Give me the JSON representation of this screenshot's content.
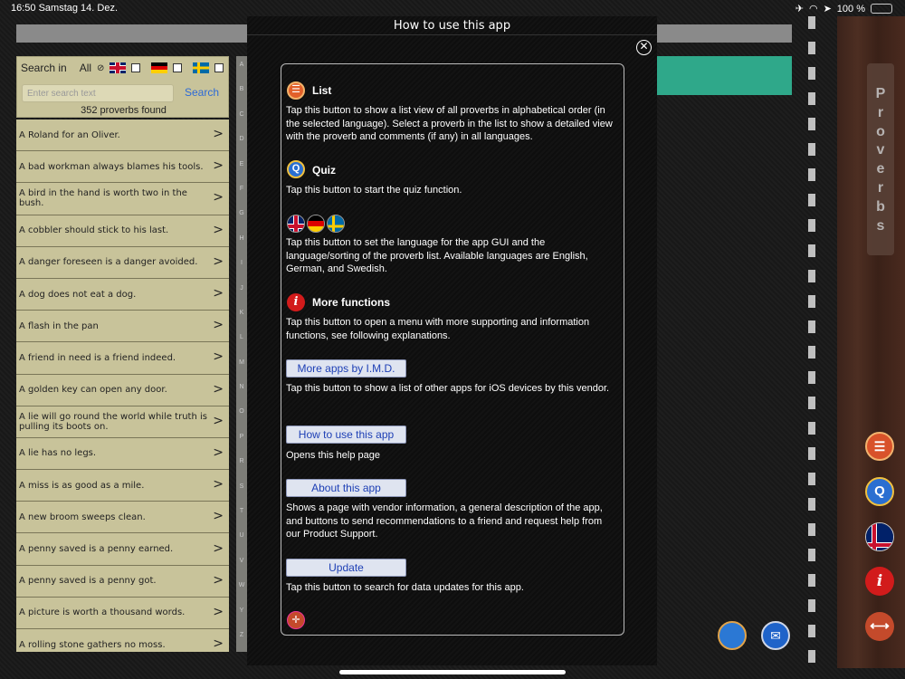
{
  "status": {
    "time": "16:50",
    "date": "Samstag 14. Dez.",
    "battery": "100 %",
    "battery_level": 1.0
  },
  "search": {
    "label": "Search in",
    "all_label": "All",
    "placeholder": "Enter search text",
    "button": "Search",
    "found": "352 proverbs found"
  },
  "proverbs": [
    "A Roland for an Oliver.",
    "A bad workman always blames his tools.",
    "A bird in the hand is worth two in the bush.",
    "A cobbler should stick to his last.",
    "A danger foreseen is a danger avoided.",
    "A dog does not eat a dog.",
    "A flash in the pan",
    "A friend in need is a friend indeed.",
    "A golden key can open any door.",
    "A lie will go round the world while truth is pulling its boots on.",
    "A lie has no legs.",
    "A miss is as good as a mile.",
    "A new broom sweeps clean.",
    "A penny saved is a penny earned.",
    "A penny saved is a penny got.",
    "A picture is worth a thousand words.",
    "A rolling stone gathers no moss."
  ],
  "alphabet": [
    "A",
    "B",
    "C",
    "D",
    "E",
    "F",
    "G",
    "H",
    "I",
    "J",
    "K",
    "L",
    "M",
    "N",
    "O",
    "P",
    "R",
    "S",
    "T",
    "U",
    "V",
    "W",
    "Y",
    "Z"
  ],
  "modal": {
    "title": "How to use this app",
    "close_icon": "close-icon",
    "list_head": "List",
    "list_text": "Tap this button to show a list view of all proverbs in alphabetical order (in the selected language). Select a proverb in the list to show a detailed view with the proverb and comments (if any) in all languages.",
    "quiz_head": "Quiz",
    "quiz_text": "Tap this button to start the quiz function.",
    "lang_text": "Tap this button to set the language for the app GUI and the language/sorting of the proverb list. Available languages are English, German, and Swedish.",
    "more_head": "More functions",
    "more_text": "Tap this button to open a menu with more supporting and information functions, see following explanations.",
    "btn_more_apps": "More apps by I.M.D.",
    "more_apps_text": "Tap this button to show a list of other apps for iOS devices by this vendor.",
    "btn_howto": "How to use this app",
    "howto_text": "Opens this help page",
    "btn_about": "About this app",
    "about_text": "Shows a page with vendor information, a general description of the app, and buttons to send recommendations to a friend and request help from our Product Support.",
    "btn_update": "Update",
    "update_text": "Tap this button to search for data updates for this app."
  },
  "side_tab": "Proverbs",
  "colors": {
    "panel": "#c8c39a",
    "teal": "#2fa88a",
    "button_text": "#1d3fb5"
  }
}
